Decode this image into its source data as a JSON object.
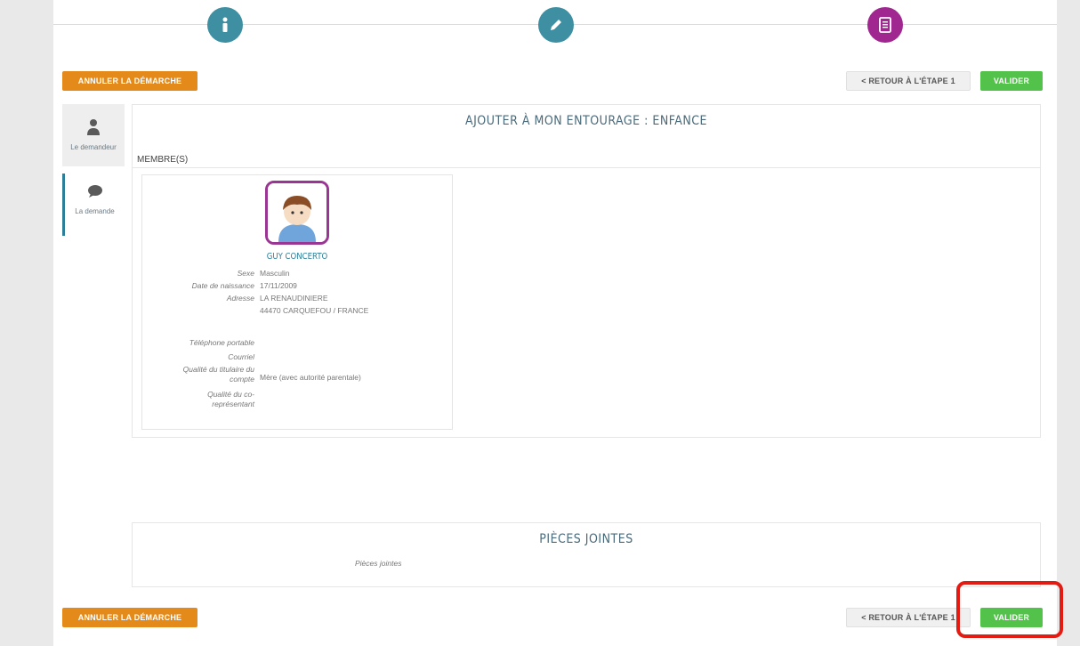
{
  "actions": {
    "cancel_label": "ANNULER LA DÉMARCHE",
    "back_label": "< RETOUR À L'ÉTAPE 1",
    "validate_label": "VALIDER"
  },
  "steps": [
    {
      "icon": "info-icon"
    },
    {
      "icon": "pencil-icon"
    },
    {
      "icon": "document-icon"
    }
  ],
  "sidebar": {
    "items": [
      {
        "label": "Le demandeur",
        "icon": "user-icon"
      },
      {
        "label": "La demande",
        "icon": "speech-bubble-icon"
      }
    ]
  },
  "main": {
    "title": "AJOUTER À MON ENTOURAGE : ENFANCE",
    "members_header": "MEMBRE(S)",
    "member": {
      "name": "GUY CONCERTO",
      "fields": {
        "sexe_label": "Sexe",
        "sexe_value": "Masculin",
        "naissance_label": "Date de naissance",
        "naissance_value": "17/11/2009",
        "adresse_label": "Adresse",
        "adresse_line1": "LA RENAUDINIERE",
        "adresse_line2": "44470 CARQUEFOU / FRANCE",
        "tel_label": "Téléphone portable",
        "courriel_label": "Courriel",
        "qualite_titulaire_label": "Qualité du titulaire du compte",
        "qualite_titulaire_value": "Mère (avec autorité parentale)",
        "qualite_co_label": "Qualité du co-représentant"
      }
    }
  },
  "attachments": {
    "title": "PIÈCES JOINTES",
    "label": "Pièces jointes"
  },
  "colors": {
    "orange": "#e38a1a",
    "green": "#52c24a",
    "teal": "#3d8fa1",
    "purple": "#a0278f",
    "highlight": "#e41b13"
  }
}
